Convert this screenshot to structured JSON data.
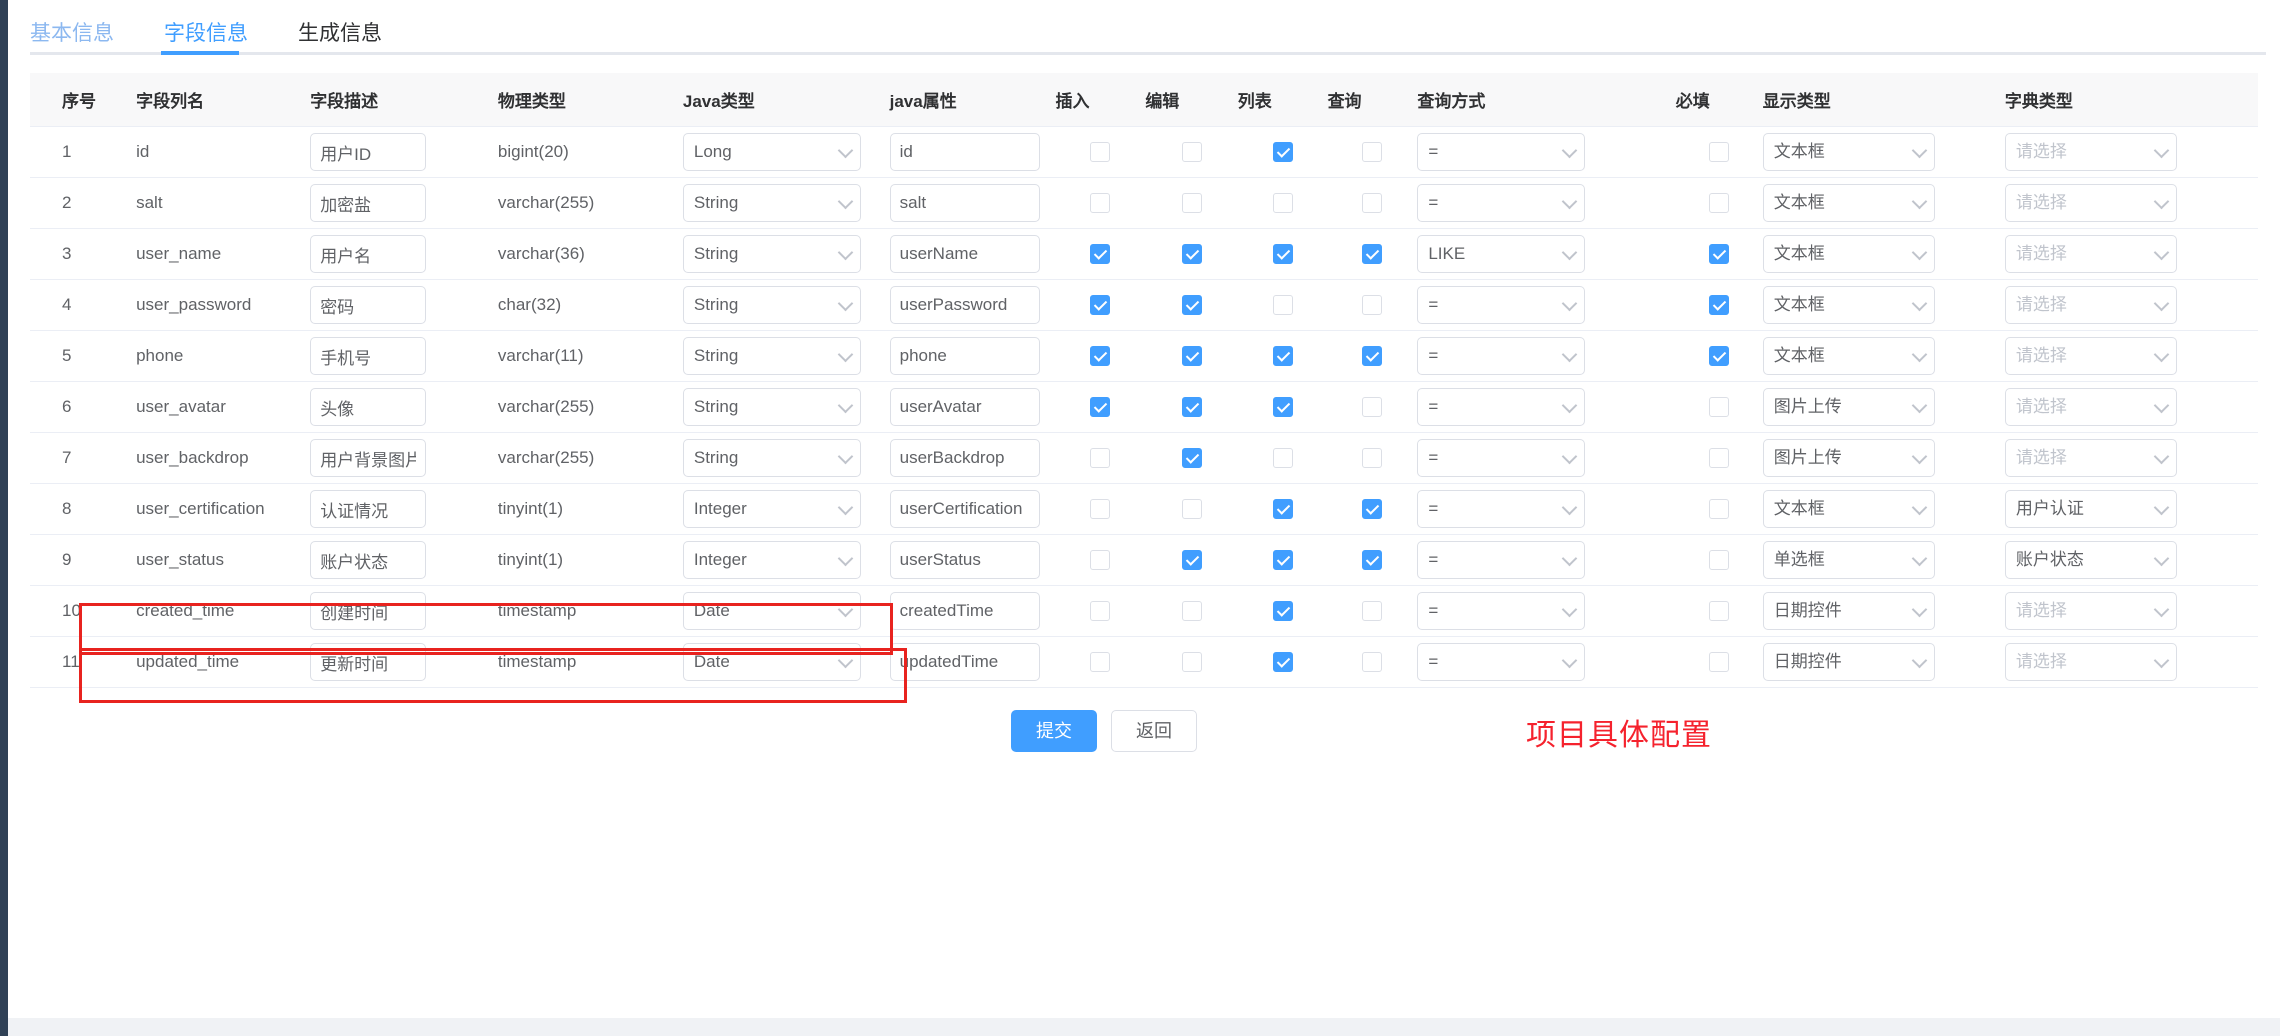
{
  "tabs": [
    {
      "label": "基本信息",
      "state": "link"
    },
    {
      "label": "字段信息",
      "state": "active"
    },
    {
      "label": "生成信息",
      "state": "plain"
    }
  ],
  "table": {
    "headers": {
      "index": "序号",
      "column": "字段列名",
      "description": "字段描述",
      "physical_type": "物理类型",
      "java_type": "Java类型",
      "java_property": "java属性",
      "insert": "插入",
      "edit": "编辑",
      "list": "列表",
      "query": "查询",
      "query_mode": "查询方式",
      "required": "必填",
      "display_type": "显示类型",
      "dict_type": "字典类型"
    },
    "dict_placeholder": "请选择",
    "rows": [
      {
        "index": "1",
        "column": "id",
        "description": "用户ID",
        "physical_type": "bigint(20)",
        "java_type": "Long",
        "java_property": "id",
        "insert": false,
        "edit": false,
        "list": true,
        "query": false,
        "query_mode": "=",
        "required": false,
        "display_type": "文本框",
        "dict_type": "请选择",
        "dict_empty": true
      },
      {
        "index": "2",
        "column": "salt",
        "description": "加密盐",
        "physical_type": "varchar(255)",
        "java_type": "String",
        "java_property": "salt",
        "insert": false,
        "edit": false,
        "list": false,
        "query": false,
        "query_mode": "=",
        "required": false,
        "display_type": "文本框",
        "dict_type": "请选择",
        "dict_empty": true
      },
      {
        "index": "3",
        "column": "user_name",
        "description": "用户名",
        "physical_type": "varchar(36)",
        "java_type": "String",
        "java_property": "userName",
        "insert": true,
        "edit": true,
        "list": true,
        "query": true,
        "query_mode": "LIKE",
        "required": true,
        "display_type": "文本框",
        "dict_type": "请选择",
        "dict_empty": true
      },
      {
        "index": "4",
        "column": "user_password",
        "description": "密码",
        "physical_type": "char(32)",
        "java_type": "String",
        "java_property": "userPassword",
        "insert": true,
        "edit": true,
        "list": false,
        "query": false,
        "query_mode": "=",
        "required": true,
        "display_type": "文本框",
        "dict_type": "请选择",
        "dict_empty": true
      },
      {
        "index": "5",
        "column": "phone",
        "description": "手机号",
        "physical_type": "varchar(11)",
        "java_type": "String",
        "java_property": "phone",
        "insert": true,
        "edit": true,
        "list": true,
        "query": true,
        "query_mode": "=",
        "required": true,
        "display_type": "文本框",
        "dict_type": "请选择",
        "dict_empty": true
      },
      {
        "index": "6",
        "column": "user_avatar",
        "description": "头像",
        "physical_type": "varchar(255)",
        "java_type": "String",
        "java_property": "userAvatar",
        "insert": true,
        "edit": true,
        "list": true,
        "query": false,
        "query_mode": "=",
        "required": false,
        "display_type": "图片上传",
        "dict_type": "请选择",
        "dict_empty": true
      },
      {
        "index": "7",
        "column": "user_backdrop",
        "description": "用户背景图片",
        "physical_type": "varchar(255)",
        "java_type": "String",
        "java_property": "userBackdrop",
        "insert": false,
        "edit": true,
        "list": false,
        "query": false,
        "query_mode": "=",
        "required": false,
        "display_type": "图片上传",
        "dict_type": "请选择",
        "dict_empty": true
      },
      {
        "index": "8",
        "column": "user_certification",
        "description": "认证情况",
        "physical_type": "tinyint(1)",
        "java_type": "Integer",
        "java_property": "userCertification",
        "insert": false,
        "edit": false,
        "list": true,
        "query": true,
        "query_mode": "=",
        "required": false,
        "display_type": "文本框",
        "dict_type": "用户认证",
        "dict_empty": false
      },
      {
        "index": "9",
        "column": "user_status",
        "description": "账户状态",
        "physical_type": "tinyint(1)",
        "java_type": "Integer",
        "java_property": "userStatus",
        "insert": false,
        "edit": true,
        "list": true,
        "query": true,
        "query_mode": "=",
        "required": false,
        "display_type": "单选框",
        "dict_type": "账户状态",
        "dict_empty": false
      },
      {
        "index": "10",
        "column": "created_time",
        "description": "创建时间",
        "physical_type": "timestamp",
        "java_type": "Date",
        "java_property": "createdTime",
        "insert": false,
        "edit": false,
        "list": true,
        "query": false,
        "query_mode": "=",
        "required": false,
        "display_type": "日期控件",
        "dict_type": "请选择",
        "dict_empty": true
      },
      {
        "index": "11",
        "column": "updated_time",
        "description": "更新时间",
        "physical_type": "timestamp",
        "java_type": "Date",
        "java_property": "updatedTime",
        "insert": false,
        "edit": false,
        "list": true,
        "query": false,
        "query_mode": "=",
        "required": false,
        "display_type": "日期控件",
        "dict_type": "请选择",
        "dict_empty": true
      }
    ]
  },
  "footer": {
    "submit_label": "提交",
    "back_label": "返回",
    "annotation": "项目具体配置",
    "annotation_color": "#f5222d"
  },
  "theme": {
    "accent": "#409eff",
    "highlight_box": "#e8231f"
  }
}
